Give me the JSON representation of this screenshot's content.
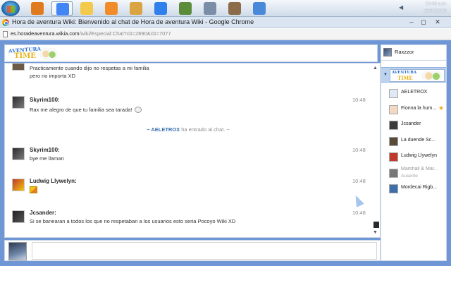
{
  "taskbar": {
    "apps": [
      {
        "name": "half-life-icon",
        "color": "#e07a1f"
      },
      {
        "name": "chrome-icon",
        "color": "#4285f4"
      },
      {
        "name": "folder-icon",
        "color": "#f2c94c"
      },
      {
        "name": "media-player-icon",
        "color": "#f28c28"
      },
      {
        "name": "game-controller-icon",
        "color": "#d9a441"
      },
      {
        "name": "internet-explorer-icon",
        "color": "#2f80ed"
      },
      {
        "name": "minecraft-icon",
        "color": "#5b8c3a"
      },
      {
        "name": "window-app-icon",
        "color": "#7a8ea8"
      },
      {
        "name": "books-icon",
        "color": "#8b6b4a"
      },
      {
        "name": "control-panel-icon",
        "color": "#4a89d9"
      }
    ],
    "clock_time": "10:48 a.m.",
    "clock_date": "26/01/2013"
  },
  "window": {
    "title": "Hora de aventura Wiki: Bienvenido al chat de Hora de aventura Wiki - Google Chrome",
    "min": "–",
    "max": "◻",
    "close": "✕"
  },
  "address": {
    "domain": "es.horadeaventura.wikia.com",
    "path": "/wiki/Especial:Chat?cb=2890&cb=7077"
  },
  "chat": {
    "messages": [
      {
        "type": "continuation",
        "lines": [
          "Practicamente cuando dijo no respetas a mi familia",
          "pero no importa XD"
        ]
      },
      {
        "type": "message",
        "user": "Skyrim100:",
        "time": "10:48",
        "text": "Rax me alegro de que tu familia sea tarada!"
      },
      {
        "type": "join",
        "user": "~ AELETROX",
        "suffix": " ha entrado al chat. ~"
      },
      {
        "type": "message",
        "user": "Skyrim100:",
        "time": "10:48",
        "text": "bye me llaman"
      },
      {
        "type": "message",
        "user": "Ludwig Llywelyn:",
        "time": "10:48",
        "text": ""
      },
      {
        "type": "message",
        "user": "Jcsander:",
        "time": "10:48",
        "text": "Si se banearan a todos los que no respetaban a los usuarios esto seria Pocoyo Wiki XD"
      }
    ],
    "scroll_up": "▲",
    "scroll_down": "▼"
  },
  "sidebar": {
    "me": "Raxzzor",
    "room_arrow": "▼",
    "users": [
      {
        "name": "AELETROX",
        "star": false,
        "away": false,
        "avatar_color": "#dfe9f5"
      },
      {
        "name": "Fionna la hum...",
        "star": true,
        "away": false,
        "avatar_color": "#f3d9c4"
      },
      {
        "name": "Jcsander",
        "star": false,
        "away": false,
        "avatar_color": "#3b3b3b"
      },
      {
        "name": "La duende Sc...",
        "star": false,
        "away": false,
        "avatar_color": "#5a4a3a"
      },
      {
        "name": "Ludwig Llywelyn",
        "star": false,
        "away": false,
        "avatar_color": "#c0392b"
      },
      {
        "name": "Marshall & Mar...",
        "status": "Ausente",
        "star": false,
        "away": true,
        "avatar_color": "#6a6a6a"
      },
      {
        "name": "Mordecai Rigb...",
        "star": false,
        "away": false,
        "avatar_color": "#3f6fa8"
      }
    ],
    "star_glyph": "★"
  },
  "logo": {
    "line1": "AVENTURA",
    "line2": "TIME"
  }
}
